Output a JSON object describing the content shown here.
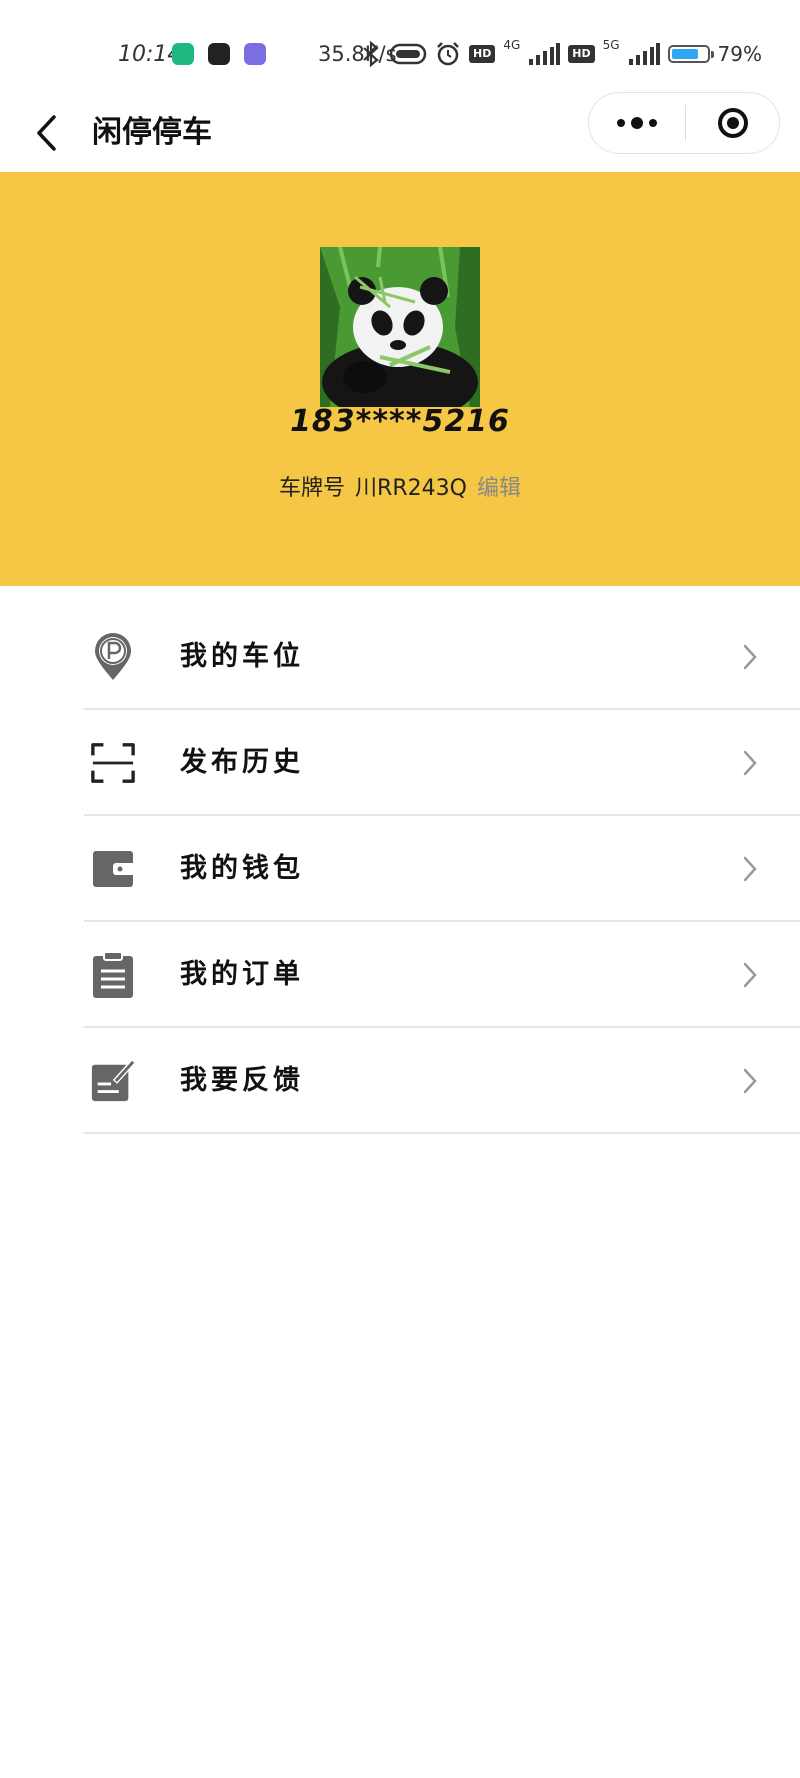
{
  "status_bar": {
    "time": "10:14",
    "net_speed": "35.8K/s",
    "hd1": "HD",
    "net1": "4G",
    "hd2": "HD",
    "net2": "5G",
    "battery_percent": 79,
    "battery_text": "79%",
    "colors": {
      "app1": "#1db97e",
      "app2": "#222222",
      "app3": "#7b6ee0",
      "battery": "#2ea7f5"
    }
  },
  "nav": {
    "title": "闲停停车",
    "back_icon": "chevron-left-icon",
    "more_icon": "more-dots-icon",
    "close_icon": "target-circle-icon"
  },
  "profile": {
    "phone": "183****5216",
    "plate_label": "车牌号",
    "plate": "川RR243Q",
    "edit_label": "编辑",
    "avatar": "panda-avatar",
    "bg_color": "#f5c744"
  },
  "menu": [
    {
      "label": "我的车位",
      "icon": "parking-pin-icon"
    },
    {
      "label": "发布历史",
      "icon": "scan-frame-icon"
    },
    {
      "label": "我的钱包",
      "icon": "wallet-icon"
    },
    {
      "label": "我的订单",
      "icon": "clipboard-icon"
    },
    {
      "label": "我要反馈",
      "icon": "edit-note-icon"
    }
  ]
}
